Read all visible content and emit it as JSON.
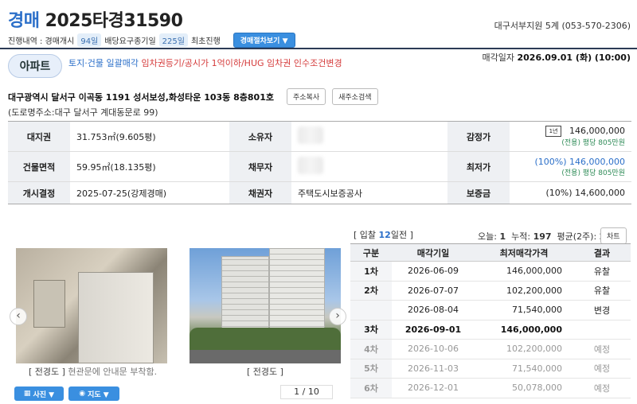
{
  "header": {
    "auction_word": "경매",
    "case_number": "2025타경31590",
    "court": "대구서부지원 5계 (053-570-2306)",
    "progress_label": "진행내역 : 경매개시",
    "days_since_start": "94일",
    "claim_label": "배당요구종기일",
    "claim_days": "225일",
    "status": "최초진행",
    "procedure_button": "경매절차보기 ▼"
  },
  "property": {
    "type_badge": "아파트",
    "tags_blue": "토지·건물 일괄매각",
    "tags_red": " 임차권등기/공시가 1억이하/HUG 임차권 인수조건변경",
    "sale_date_label": "매각일자",
    "sale_date": "2026.09.01 (화) (10:00)",
    "address": "대구광역시 달서구 이곡동 1191 성서보성,화성타운 103동 8층801호",
    "copy_address_button": "주소복사",
    "new_address_button": "새주소검색",
    "road_address": "(도로명주소:대구 달서구 계대동문로 99)"
  },
  "info": {
    "land_label": "대지권",
    "land_value": "31.753㎡(9.605평)",
    "owner_label": "소유자",
    "appraisal_label": "감정가",
    "appraisal_badge": "1년",
    "appraisal_value": "146,000,000",
    "appraisal_sub": "(전용) 평당 805만원",
    "building_label": "건물면적",
    "building_value": "59.95㎡(18.135평)",
    "debtor_label": "채무자",
    "min_label": "최저가",
    "min_value": "(100%) 146,000,000",
    "min_sub": "(전용) 평당 805만원",
    "start_label": "개시결정",
    "start_value": "2025-07-25(강제경매)",
    "creditor_label": "채권자",
    "creditor_value": "주택도시보증공사",
    "deposit_label": "보증금",
    "deposit_value": "(10%) 14,600,000"
  },
  "photos": {
    "caption1_tag": "[ 전경도 ]",
    "caption1_text": " 현관문에 안내문 부착함.",
    "caption2": "[ 전경도 ]",
    "photo_button": "사진 ▼",
    "map_button": "지도 ▼",
    "pager": "1 / 10"
  },
  "bidding": {
    "head_pre": "[ 입찰 ",
    "head_days": "12",
    "head_post": "일전 ]",
    "today_label": "오늘: ",
    "today": "1",
    "total_label": "누적: ",
    "total": "197",
    "avg_label": "평균(2주): ",
    "avg": "2",
    "chart_button": "차트",
    "columns": [
      "구분",
      "매각기일",
      "최저매각가격",
      "결과"
    ],
    "rows": [
      {
        "round": "1차",
        "date": "2026-06-09",
        "price": "146,000,000",
        "result": "유찰"
      },
      {
        "round": "2차",
        "date": "2026-07-07",
        "price": "102,200,000",
        "result": "유찰"
      },
      {
        "round": "",
        "date": "2026-08-04",
        "price": "71,540,000",
        "result": "변경"
      },
      {
        "round": "3차",
        "date": "2026-09-01",
        "price": "146,000,000",
        "result": ""
      },
      {
        "round": "4차",
        "date": "2026-10-06",
        "price": "102,200,000",
        "result": "예정"
      },
      {
        "round": "5차",
        "date": "2026-11-03",
        "price": "71,540,000",
        "result": "예정"
      },
      {
        "round": "6차",
        "date": "2026-12-01",
        "price": "50,078,000",
        "result": "예정"
      }
    ]
  }
}
